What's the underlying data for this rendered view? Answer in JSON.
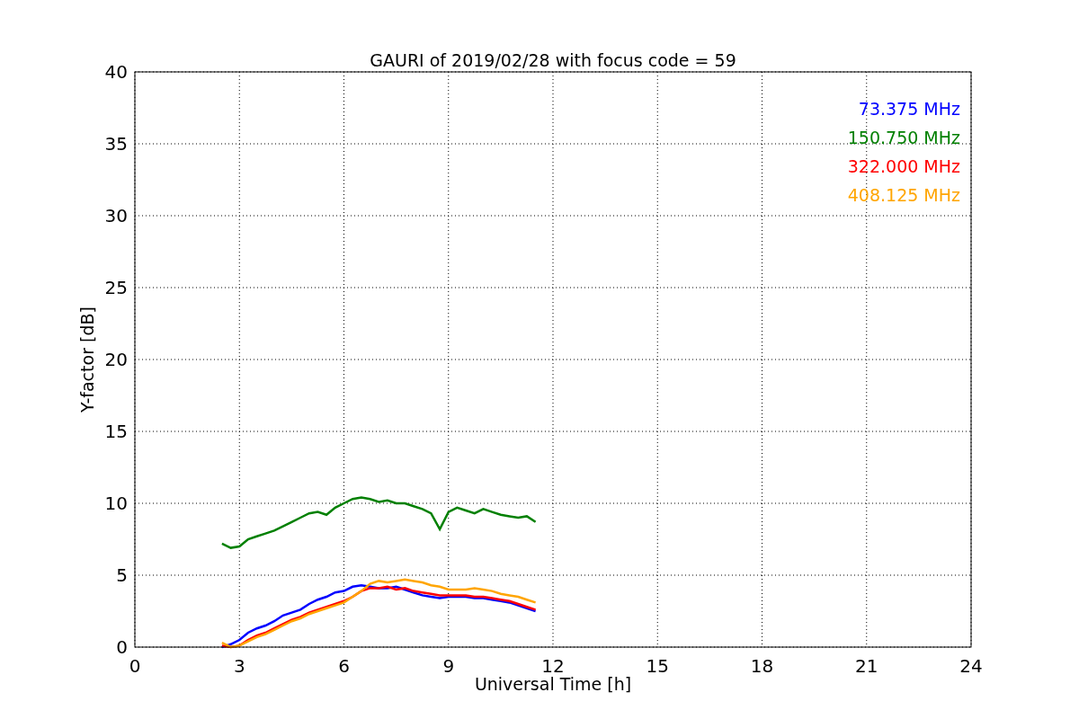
{
  "chart_data": {
    "type": "line",
    "title": "GAURI of 2019/02/28 with focus code = 59",
    "xlabel": "Universal Time [h]",
    "ylabel": "Y-factor [dB]",
    "grid": true,
    "xlim": [
      0,
      24
    ],
    "ylim": [
      0,
      40
    ],
    "xticks": [
      0,
      3,
      6,
      9,
      12,
      15,
      18,
      21,
      24
    ],
    "yticks": [
      0,
      5,
      10,
      15,
      20,
      25,
      30,
      35,
      40
    ],
    "x": [
      2.5,
      2.75,
      3,
      3.25,
      3.5,
      3.75,
      4,
      4.25,
      4.5,
      4.75,
      5,
      5.25,
      5.5,
      5.75,
      6,
      6.25,
      6.5,
      6.75,
      7,
      7.25,
      7.5,
      7.75,
      8,
      8.25,
      8.5,
      8.75,
      9,
      9.25,
      9.5,
      9.75,
      10,
      10.25,
      10.5,
      10.75,
      11,
      11.25,
      11.5
    ],
    "series": [
      {
        "name": "73.375 MHz",
        "color": "#0000ff",
        "values": [
          0,
          0.2,
          0.5,
          1.0,
          1.3,
          1.5,
          1.8,
          2.2,
          2.4,
          2.6,
          3.0,
          3.3,
          3.5,
          3.8,
          3.9,
          4.2,
          4.3,
          4.2,
          4.1,
          4.1,
          4.2,
          4.0,
          3.8,
          3.6,
          3.5,
          3.4,
          3.5,
          3.5,
          3.5,
          3.4,
          3.4,
          3.3,
          3.2,
          3.1,
          2.9,
          2.7,
          2.5
        ]
      },
      {
        "name": "150.750 MHz",
        "color": "#008000",
        "values": [
          7.2,
          6.9,
          7.0,
          7.5,
          7.7,
          7.9,
          8.1,
          8.4,
          8.7,
          9.0,
          9.3,
          9.4,
          9.2,
          9.7,
          10.0,
          10.3,
          10.4,
          10.3,
          10.1,
          10.2,
          10.0,
          10.0,
          9.8,
          9.6,
          9.3,
          8.2,
          9.4,
          9.7,
          9.5,
          9.3,
          9.6,
          9.4,
          9.2,
          9.1,
          9.0,
          9.1,
          8.7
        ]
      },
      {
        "name": "322.000 MHz",
        "color": "#ff0000",
        "values": [
          0.1,
          0,
          0.1,
          0.5,
          0.8,
          1.0,
          1.3,
          1.6,
          1.9,
          2.1,
          2.4,
          2.6,
          2.8,
          3.0,
          3.2,
          3.5,
          3.9,
          4.1,
          4.1,
          4.2,
          4.0,
          4.1,
          3.9,
          3.8,
          3.7,
          3.6,
          3.6,
          3.6,
          3.6,
          3.5,
          3.5,
          3.4,
          3.3,
          3.2,
          3.0,
          2.8,
          2.6
        ]
      },
      {
        "name": "408.125 MHz",
        "color": "#ffa500",
        "values": [
          0.3,
          0,
          0.1,
          0.4,
          0.7,
          0.9,
          1.2,
          1.5,
          1.8,
          2.0,
          2.3,
          2.5,
          2.7,
          2.9,
          3.1,
          3.5,
          3.9,
          4.4,
          4.6,
          4.5,
          4.6,
          4.7,
          4.6,
          4.5,
          4.3,
          4.2,
          4.0,
          4.0,
          4.0,
          4.1,
          4.0,
          3.9,
          3.7,
          3.6,
          3.5,
          3.3,
          3.1
        ]
      }
    ]
  }
}
